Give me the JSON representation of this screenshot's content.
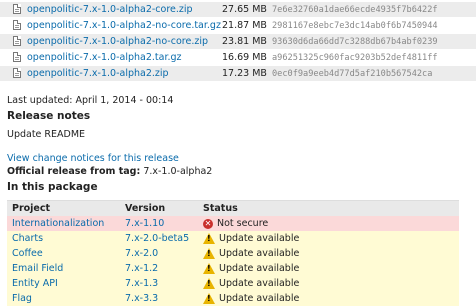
{
  "downloads": [
    {
      "name": "openpolitic-7.x-1.0-alpha2-core.zip",
      "size": "27.65 MB",
      "hash": "7e6e32760a1dae66ecde4935f7b6422f"
    },
    {
      "name": "openpolitic-7.x-1.0-alpha2-no-core.tar.gz",
      "size": "21.87 MB",
      "hash": "2981167e8ebc7e3dc14ab0f6b7450944"
    },
    {
      "name": "openpolitic-7.x-1.0-alpha2-no-core.zip",
      "size": "23.81 MB",
      "hash": "93630d6da66dd7c3288db67b4abf0239"
    },
    {
      "name": "openpolitic-7.x-1.0-alpha2.tar.gz",
      "size": "16.69 MB",
      "hash": "a96251325c960fac9203b52def4811ff"
    },
    {
      "name": "openpolitic-7.x-1.0-alpha2.zip",
      "size": "17.23 MB",
      "hash": "0ec0f9a9eeb4d77d5af210b567542ca"
    }
  ],
  "last_updated": "Last updated: April 1, 2014 - 00:14",
  "release_notes": {
    "heading": "Release notes",
    "text": "Update README"
  },
  "view_change_notices": "View change notices for this release",
  "official_release": {
    "label": "Official release from tag:",
    "tag": "7.x-1.0-alpha2"
  },
  "package": {
    "heading": "In this package",
    "columns": [
      "Project",
      "Version",
      "Status"
    ],
    "rows": [
      {
        "project": "Internationalization",
        "version": "7.x-1.10",
        "status": "Not secure",
        "level": "bad"
      },
      {
        "project": "Charts",
        "version": "7.x-2.0-beta5",
        "status": "Update available",
        "level": "warn"
      },
      {
        "project": "Coffee",
        "version": "7.x-2.0",
        "status": "Update available",
        "level": "warn"
      },
      {
        "project": "Email Field",
        "version": "7.x-1.2",
        "status": "Update available",
        "level": "warn"
      },
      {
        "project": "Entity API",
        "version": "7.x-1.3",
        "status": "Update available",
        "level": "warn"
      },
      {
        "project": "Flag",
        "version": "7.x-3.3",
        "status": "Update available",
        "level": "warn"
      }
    ]
  }
}
